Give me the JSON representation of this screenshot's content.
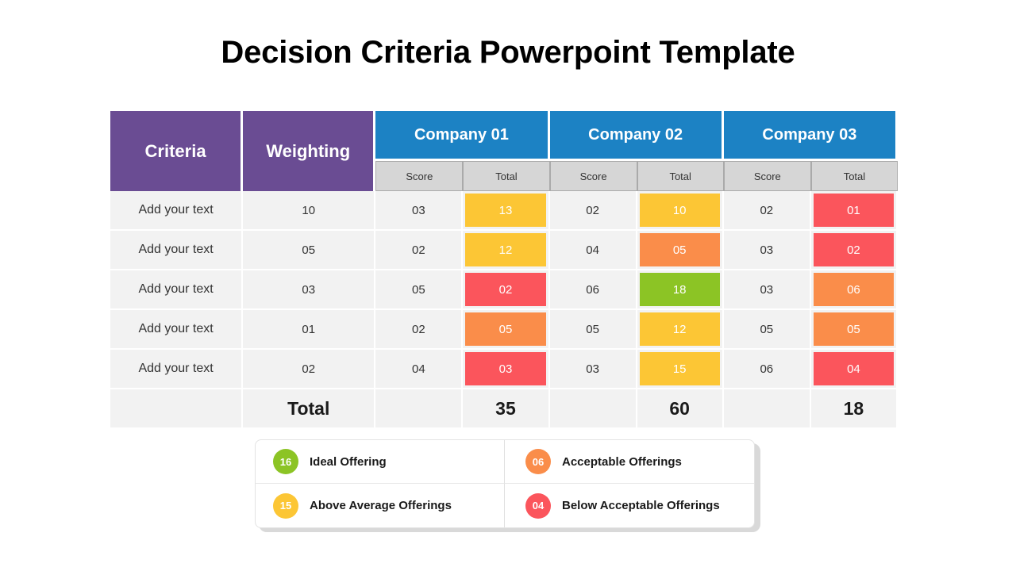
{
  "title": "Decision Criteria Powerpoint Template",
  "colors": {
    "purple": "#6A4C93",
    "blue": "#1C82C4",
    "green": "#8CC425",
    "yellow": "#FCC635",
    "orange": "#FA8D4A",
    "red": "#FB555C",
    "row_bg": "#F2F2F2",
    "subheader_bg": "#D6D6D6"
  },
  "table": {
    "headers": {
      "criteria": "Criteria",
      "weighting": "Weighting",
      "companies": [
        "Company 01",
        "Company 02",
        "Company 03"
      ],
      "sub": [
        "Score",
        "Total"
      ]
    },
    "rows": [
      {
        "criteria": "Add your text",
        "weighting": "10",
        "cells": [
          {
            "score": "03",
            "total": "13",
            "color": "#FCC635"
          },
          {
            "score": "02",
            "total": "10",
            "color": "#FCC635"
          },
          {
            "score": "02",
            "total": "01",
            "color": "#FB555C"
          }
        ]
      },
      {
        "criteria": "Add your text",
        "weighting": "05",
        "cells": [
          {
            "score": "02",
            "total": "12",
            "color": "#FCC635"
          },
          {
            "score": "04",
            "total": "05",
            "color": "#FA8D4A"
          },
          {
            "score": "03",
            "total": "02",
            "color": "#FB555C"
          }
        ]
      },
      {
        "criteria": "Add your text",
        "weighting": "03",
        "cells": [
          {
            "score": "05",
            "total": "02",
            "color": "#FB555C"
          },
          {
            "score": "06",
            "total": "18",
            "color": "#8CC425"
          },
          {
            "score": "03",
            "total": "06",
            "color": "#FA8D4A"
          }
        ]
      },
      {
        "criteria": "Add your text",
        "weighting": "01",
        "cells": [
          {
            "score": "02",
            "total": "05",
            "color": "#FA8D4A"
          },
          {
            "score": "05",
            "total": "12",
            "color": "#FCC635"
          },
          {
            "score": "05",
            "total": "05",
            "color": "#FA8D4A"
          }
        ]
      },
      {
        "criteria": "Add your text",
        "weighting": "02",
        "cells": [
          {
            "score": "04",
            "total": "03",
            "color": "#FB555C"
          },
          {
            "score": "03",
            "total": "15",
            "color": "#FCC635"
          },
          {
            "score": "06",
            "total": "04",
            "color": "#FB555C"
          }
        ]
      }
    ],
    "totals": {
      "label": "Total",
      "values": [
        "35",
        "60",
        "18"
      ]
    }
  },
  "legend": {
    "items": [
      {
        "value": "16",
        "label": "Ideal Offering",
        "color": "#8CC425"
      },
      {
        "value": "06",
        "label": "Acceptable Offerings",
        "color": "#FA8D4A"
      },
      {
        "value": "15",
        "label": "Above Average Offerings",
        "color": "#FCC635"
      },
      {
        "value": "04",
        "label": "Below Acceptable Offerings",
        "color": "#FB555C"
      }
    ]
  }
}
